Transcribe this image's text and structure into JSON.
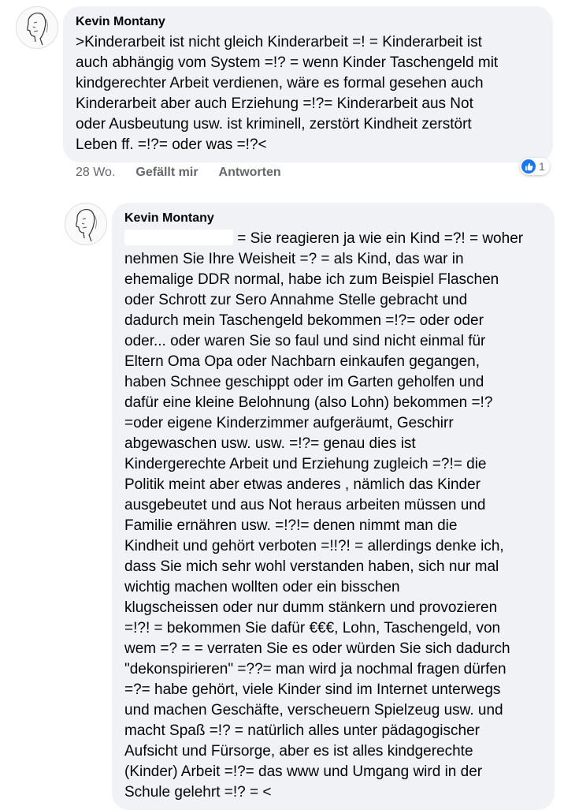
{
  "comment1": {
    "author": "Kevin Montany",
    "text": ">Kinderarbeit ist nicht gleich Kinderarbeit =! = Kinderarbeit ist\nauch abhängig vom System =!? = wenn Kinder Taschengeld mit\nkindgerechter Arbeit verdienen, wäre es formal gesehen auch\nKinderarbeit aber auch Erziehung =!?= Kinderarbeit aus Not\noder Ausbeutung usw. ist kriminell, zerstört Kindheit zerstört\nLeben ff. =!?= oder was =!?<",
    "time": "28 Wo.",
    "like_label": "Gefällt mir",
    "reply_label": "Antworten",
    "reaction_count": "1",
    "reaction_icon": "thumbs-up-icon",
    "reaction_color": "#1877f2"
  },
  "comment2": {
    "author": "Kevin Montany",
    "text_first": " = Sie reagieren ja wie ein Kind =?! = woher",
    "text": "nehmen Sie Ihre Weisheit =? = als Kind, das war in\nehemalige DDR normal, habe ich zum Beispiel Flaschen\noder Schrott zur Sero Annahme Stelle gebracht und\ndadurch mein Taschengeld bekommen =!?= oder oder\noder... oder waren Sie so faul und sind nicht einmal  für\nEltern Oma Opa oder Nachbarn einkaufen  gegangen,\nhaben Schnee geschippt  oder im Garten geholfen und\ndafür eine kleine Belohnung (also Lohn) bekommen =!?\n=oder eigene Kinderzimmer aufgeräumt, Geschirr\nabgewaschen usw. usw. =!?= genau dies ist\nKindergerechte Arbeit und Erziehung zugleich =?!= die\nPolitik meint aber etwas anderes , nämlich das Kinder\nausgebeutet und aus Not heraus arbeiten müssen und\nFamilie ernähren usw. =!?!= denen nimmt man die\nKindheit und gehört verboten =!!?! = allerdings denke ich,\ndass Sie mich sehr wohl verstanden haben,  sich nur mal\nwichtig machen wollten oder ein bisschen\nklugscheissen oder nur dumm stänkern und provozieren\n=!?! = bekommen Sie dafür €€€, Lohn, Taschengeld, von\nwem =? = = verraten Sie es oder würden Sie sich dadurch\n\"dekonspirieren\" =??= man wird ja nochmal fragen dürfen\n=?= habe gehört, viele Kinder sind im Internet unterwegs\nund machen Geschäfte, verscheuern Spielzeug usw. und\nmacht Spaß =!? = natürlich alles unter pädagogischer\nAufsicht und Fürsorge, aber es ist alles kindgerechte\n(Kinder) Arbeit =!?= das www und Umgang  wird in der\nSchule gelehrt =!? = <"
  },
  "icons": {
    "avatar": "sketch-portrait-avatar"
  }
}
